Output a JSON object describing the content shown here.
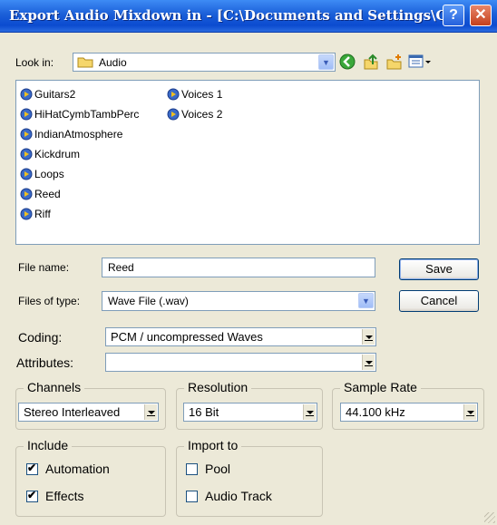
{
  "window": {
    "title": "Export Audio Mixdown in - [C:\\Documents and Settings\\C...",
    "help_glyph": "?",
    "close_glyph": "✕"
  },
  "lookin": {
    "label": "Look in:",
    "value": "Audio"
  },
  "files": [
    {
      "name": "Guitars2",
      "icon": "audio-file-icon"
    },
    {
      "name": "HiHatCymbTambPerc",
      "icon": "audio-file-icon"
    },
    {
      "name": "IndianAtmosphere",
      "icon": "audio-file-icon"
    },
    {
      "name": "Kickdrum",
      "icon": "audio-file-icon"
    },
    {
      "name": "Loops",
      "icon": "audio-file-icon"
    },
    {
      "name": "Reed",
      "icon": "audio-file-icon"
    },
    {
      "name": "Riff",
      "icon": "audio-file-icon"
    },
    {
      "name": "Voices 1",
      "icon": "audio-file-icon"
    },
    {
      "name": "Voices 2",
      "icon": "audio-file-icon"
    }
  ],
  "filename": {
    "label": "File name:",
    "value": "Reed"
  },
  "filetype": {
    "label": "Files of type:",
    "value": "Wave File (.wav)"
  },
  "buttons": {
    "save": "Save",
    "cancel": "Cancel"
  },
  "coding": {
    "label": "Coding:",
    "value": "PCM / uncompressed Waves"
  },
  "attributes": {
    "label": "Attributes:",
    "value": ""
  },
  "channels": {
    "title": "Channels",
    "value": "Stereo Interleaved"
  },
  "resolution": {
    "title": "Resolution",
    "value": "16 Bit"
  },
  "samplerate": {
    "title": "Sample Rate",
    "value": "44.100 kHz"
  },
  "include": {
    "title": "Include",
    "automation": {
      "label": "Automation",
      "checked": true
    },
    "effects": {
      "label": "Effects",
      "checked": true
    }
  },
  "import_to": {
    "title": "Import to",
    "pool": {
      "label": "Pool",
      "checked": false
    },
    "audio_track": {
      "label": "Audio Track",
      "checked": false
    }
  },
  "colors": {
    "titlebar": "#0b4bd0",
    "face": "#ece9d8",
    "field_border": "#7f9db9"
  }
}
